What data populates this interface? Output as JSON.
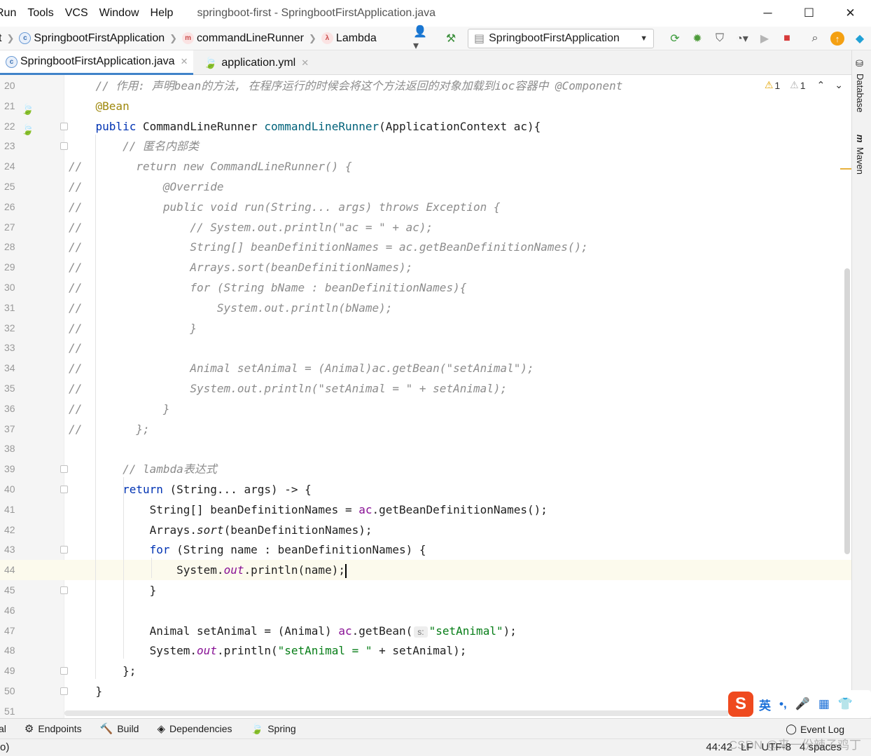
{
  "menu": [
    "Run",
    "Tools",
    "VCS",
    "Window",
    "Help"
  ],
  "window_title": "springboot-first - SpringbootFirstApplication.java",
  "window_controls": {
    "minimize": "─",
    "maximize": "☐",
    "close": "✕"
  },
  "breadcrumb": {
    "prefix": "t",
    "class_name": "SpringbootFirstApplication",
    "method": "commandLineRunner",
    "lambda": "Lambda"
  },
  "run_config": "SpringbootFirstApplication",
  "tabs": [
    {
      "label": "SpringbootFirstApplication.java",
      "active": true
    },
    {
      "label": "application.yml",
      "active": false
    }
  ],
  "right_tools": [
    "Database",
    "Maven"
  ],
  "inspections": {
    "warnings": "1",
    "weak_warnings": "1"
  },
  "lines": [
    {
      "n": "20",
      "html": "    <span class=\"cm\">// 作用: 声明bean的方法, 在程序运行的时候会将这个方法返回的对象加载到ioc容器中 @Component</span>"
    },
    {
      "n": "21",
      "html": "    <span class=\"an\">@Bean</span>"
    },
    {
      "n": "22",
      "html": "    <span class=\"kw\">public</span> CommandLineRunner <span class=\"mt\">commandLineRunner</span>(ApplicationContext ac){"
    },
    {
      "n": "23",
      "html": "        <span class=\"cm\">// 匿名内部类</span>"
    },
    {
      "n": "24",
      "html": "<span class=\"cm\">//        return new CommandLineRunner() {</span>"
    },
    {
      "n": "25",
      "html": "<span class=\"cm\">//            @Override</span>"
    },
    {
      "n": "26",
      "html": "<span class=\"cm\">//            public void run(String... args) throws Exception {</span>"
    },
    {
      "n": "27",
      "html": "<span class=\"cm\">//                // System.out.println(\"ac = \" + ac);</span>"
    },
    {
      "n": "28",
      "html": "<span class=\"cm\">//                String[] beanDefinitionNames = ac.getBeanDefinitionNames();</span>"
    },
    {
      "n": "29",
      "html": "<span class=\"cm\">//                Arrays.sort(beanDefinitionNames);</span>"
    },
    {
      "n": "30",
      "html": "<span class=\"cm\">//                for (String bName : beanDefinitionNames){</span>"
    },
    {
      "n": "31",
      "html": "<span class=\"cm\">//                    System.out.println(bName);</span>"
    },
    {
      "n": "32",
      "html": "<span class=\"cm\">//                }</span>"
    },
    {
      "n": "33",
      "html": "<span class=\"cm\">//</span>"
    },
    {
      "n": "34",
      "html": "<span class=\"cm\">//                Animal setAnimal = (Animal)ac.getBean(\"setAnimal\");</span>"
    },
    {
      "n": "35",
      "html": "<span class=\"cm\">//                System.out.println(\"setAnimal = \" + setAnimal);</span>"
    },
    {
      "n": "36",
      "html": "<span class=\"cm\">//            }</span>"
    },
    {
      "n": "37",
      "html": "<span class=\"cm\">//        };</span>"
    },
    {
      "n": "38",
      "html": ""
    },
    {
      "n": "39",
      "html": "        <span class=\"cm\">// lambda表达式</span>"
    },
    {
      "n": "40",
      "html": "        <span class=\"kw\">return</span> (String... args) -> {"
    },
    {
      "n": "41",
      "html": "            String[] beanDefinitionNames = <span class=\"fd\" style=\"font-style:normal\">ac</span>.getBeanDefinitionNames();"
    },
    {
      "n": "42",
      "html": "            Arrays.<span class=\"sm\">sort</span>(beanDefinitionNames);"
    },
    {
      "n": "43",
      "html": "            <span class=\"kw\">for</span> (String name : beanDefinitionNames) {"
    },
    {
      "n": "44",
      "html": "                System.<span class=\"fd\">out</span>.println(name);<span class=\"caret\"></span>"
    },
    {
      "n": "45",
      "html": "            }"
    },
    {
      "n": "46",
      "html": ""
    },
    {
      "n": "47",
      "html": "            Animal setAnimal = (Animal) <span class=\"fd\" style=\"font-style:normal\">ac</span>.getBean(<span class=\"hint\">s:</span><span class=\"st\">\"setAnimal\"</span>);"
    },
    {
      "n": "48",
      "html": "            System.<span class=\"fd\">out</span>.println(<span class=\"st\">\"setAnimal = \"</span> + setAnimal);"
    },
    {
      "n": "49",
      "html": "        };"
    },
    {
      "n": "50",
      "html": "    }"
    },
    {
      "n": "51",
      "html": ""
    }
  ],
  "bottom_tools": [
    {
      "label": "al",
      "icon": ""
    },
    {
      "label": "Endpoints",
      "icon": "⚙"
    },
    {
      "label": "Build",
      "icon": "🔨"
    },
    {
      "label": "Dependencies",
      "icon": "◈"
    },
    {
      "label": "Spring",
      "icon": "🍃"
    }
  ],
  "event_log": "Event Log",
  "status": {
    "left": "o)",
    "position": "44:42",
    "line_sep": "LF",
    "encoding": "UTF-8",
    "indent": "4 spaces"
  },
  "watermark": "CSDN @来一份辣子鸡丁",
  "ime": {
    "lang": "英",
    "punct": "•,",
    "mic": "🎤",
    "keyboard": "▦",
    "shirt": "👕"
  }
}
